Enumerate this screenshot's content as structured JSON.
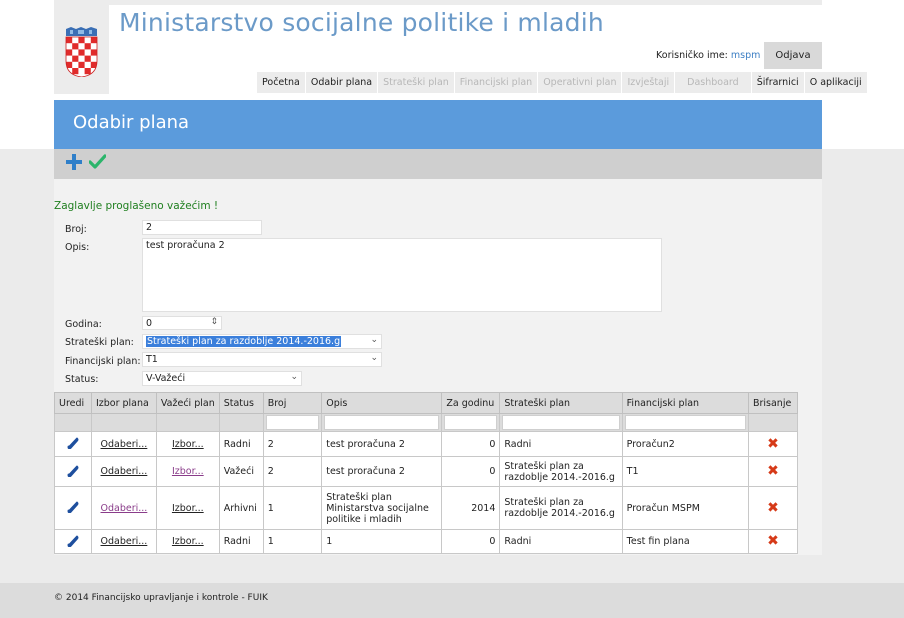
{
  "header": {
    "site_title": "Ministarstvo socijalne politike i mladih",
    "user_label": "Korisničko ime:",
    "username": "mspm",
    "logout_label": "Odjava"
  },
  "nav": {
    "items": [
      {
        "label": "Početna",
        "state": "active"
      },
      {
        "label": "Odabir plana",
        "state": "active"
      },
      {
        "label": "Strateški plan",
        "state": "disabled"
      },
      {
        "label": "Financijski plan",
        "state": "disabled"
      },
      {
        "label": "Operativni plan",
        "state": "disabled"
      },
      {
        "label": "Izvještaji",
        "state": "disabled"
      },
      {
        "label": "Dashboard",
        "state": "disabled"
      },
      {
        "label": "Šifrarnici",
        "state": "active"
      },
      {
        "label": "O aplikaciji",
        "state": "active"
      }
    ]
  },
  "page": {
    "title": "Odabir plana",
    "message": "Zaglavlje proglašeno važećim !"
  },
  "form": {
    "broj_label": "Broj:",
    "broj_value": "2",
    "opis_label": "Opis:",
    "opis_value": "test proračuna 2",
    "godina_label": "Godina:",
    "godina_value": "0",
    "strateski_label": "Strateški plan:",
    "strateski_value": "Strateški plan za razdoblje 2014.-2016.g",
    "financijski_label": "Financijski plan:",
    "financijski_value": "T1",
    "status_label": "Status:",
    "status_value": "V-Važeći"
  },
  "table": {
    "headers": [
      "Uredi",
      "Izbor plana",
      "Važeći plan",
      "Status",
      "Broj",
      "Opis",
      "Za godinu",
      "Strateški plan",
      "Financijski plan",
      "Brisanje"
    ],
    "rows": [
      {
        "izbor": "Odaberi...",
        "vazeci": "Izbor...",
        "status": "Radni",
        "broj": "2",
        "opis": "test proračuna 2",
        "godina": "0",
        "strateski": "Radni",
        "financijski": "Proračun2"
      },
      {
        "izbor": "Odaberi...",
        "vazeci": "Izbor...",
        "status": "Važeći",
        "broj": "2",
        "opis": "test proračuna 2",
        "godina": "0",
        "strateski": "Strateški plan za razdoblje 2014.-2016.g",
        "financijski": "T1"
      },
      {
        "izbor": "Odaberi...",
        "vazeci": "Izbor...",
        "status": "Arhivni",
        "broj": "1",
        "opis": "Strateški plan Ministarstva socijalne politike i mladih",
        "godina": "2014",
        "strateski": "Strateški plan za razdoblje 2014.-2016.g",
        "financijski": "Proračun MSPM"
      },
      {
        "izbor": "Odaberi...",
        "vazeci": "Izbor...",
        "status": "Radni",
        "broj": "1",
        "opis": "1",
        "godina": "0",
        "strateski": "Radni",
        "financijski": "Test fin plana"
      }
    ]
  },
  "footer": {
    "text": "© 2014 Financijsko upravljanje i kontrole - FUIK"
  },
  "colors": {
    "banner": "#5b9bdc",
    "title": "#6b9ac8",
    "success": "#1f7f1f",
    "delete": "#d63a18",
    "plus": "#2f7fc9",
    "check": "#2bb56b"
  },
  "icons": {
    "add": "plus-icon",
    "confirm": "check-icon",
    "edit": "pencil-icon",
    "delete": "x-icon",
    "logo": "croatian-coat-of-arms"
  }
}
